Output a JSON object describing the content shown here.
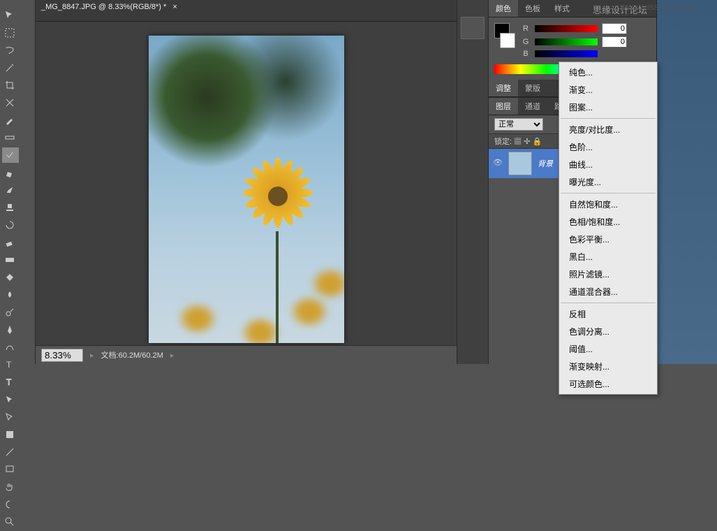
{
  "document": {
    "tab_title": "_MG_8847.JPG @ 8.33%(RGB/8*) *",
    "close_x": "×"
  },
  "statusbar": {
    "zoom": "8.33%",
    "doc_label": "文档:60.2M/60.2M"
  },
  "color_panel": {
    "tabs": [
      "颜色",
      "色板",
      "样式"
    ],
    "channels": {
      "r": {
        "label": "R",
        "value": "0"
      },
      "g": {
        "label": "G",
        "value": "0"
      },
      "b": {
        "label": "B",
        "value": ""
      }
    }
  },
  "adjust_panel": {
    "tabs": [
      "调整",
      "蒙版"
    ]
  },
  "layers_panel": {
    "tabs": [
      "图层",
      "通道",
      "路径"
    ],
    "blend_mode": "正常",
    "lock_label": "锁定:",
    "layer_name": "背景"
  },
  "context_menu": {
    "items": [
      {
        "label": "纯色...",
        "sep": false
      },
      {
        "label": "渐变...",
        "sep": false
      },
      {
        "label": "图案...",
        "sep": true
      },
      {
        "label": "亮度/对比度...",
        "sep": false
      },
      {
        "label": "色阶...",
        "sep": false
      },
      {
        "label": "曲线...",
        "sep": false
      },
      {
        "label": "曝光度...",
        "sep": true
      },
      {
        "label": "自然饱和度...",
        "sep": false
      },
      {
        "label": "色相/饱和度...",
        "sep": false
      },
      {
        "label": "色彩平衡...",
        "sep": false
      },
      {
        "label": "黑白...",
        "sep": false
      },
      {
        "label": "照片滤镜...",
        "sep": false
      },
      {
        "label": "通道混合器...",
        "sep": true
      },
      {
        "label": "反相",
        "sep": false
      },
      {
        "label": "色调分离...",
        "sep": false
      },
      {
        "label": "阈值...",
        "sep": false
      },
      {
        "label": "渐变映射...",
        "sep": false
      },
      {
        "label": "可选颜色...",
        "sep": false
      }
    ]
  },
  "watermark": "思缘设计论坛",
  "watermark2": "WWW.MISSYUAN.COM"
}
